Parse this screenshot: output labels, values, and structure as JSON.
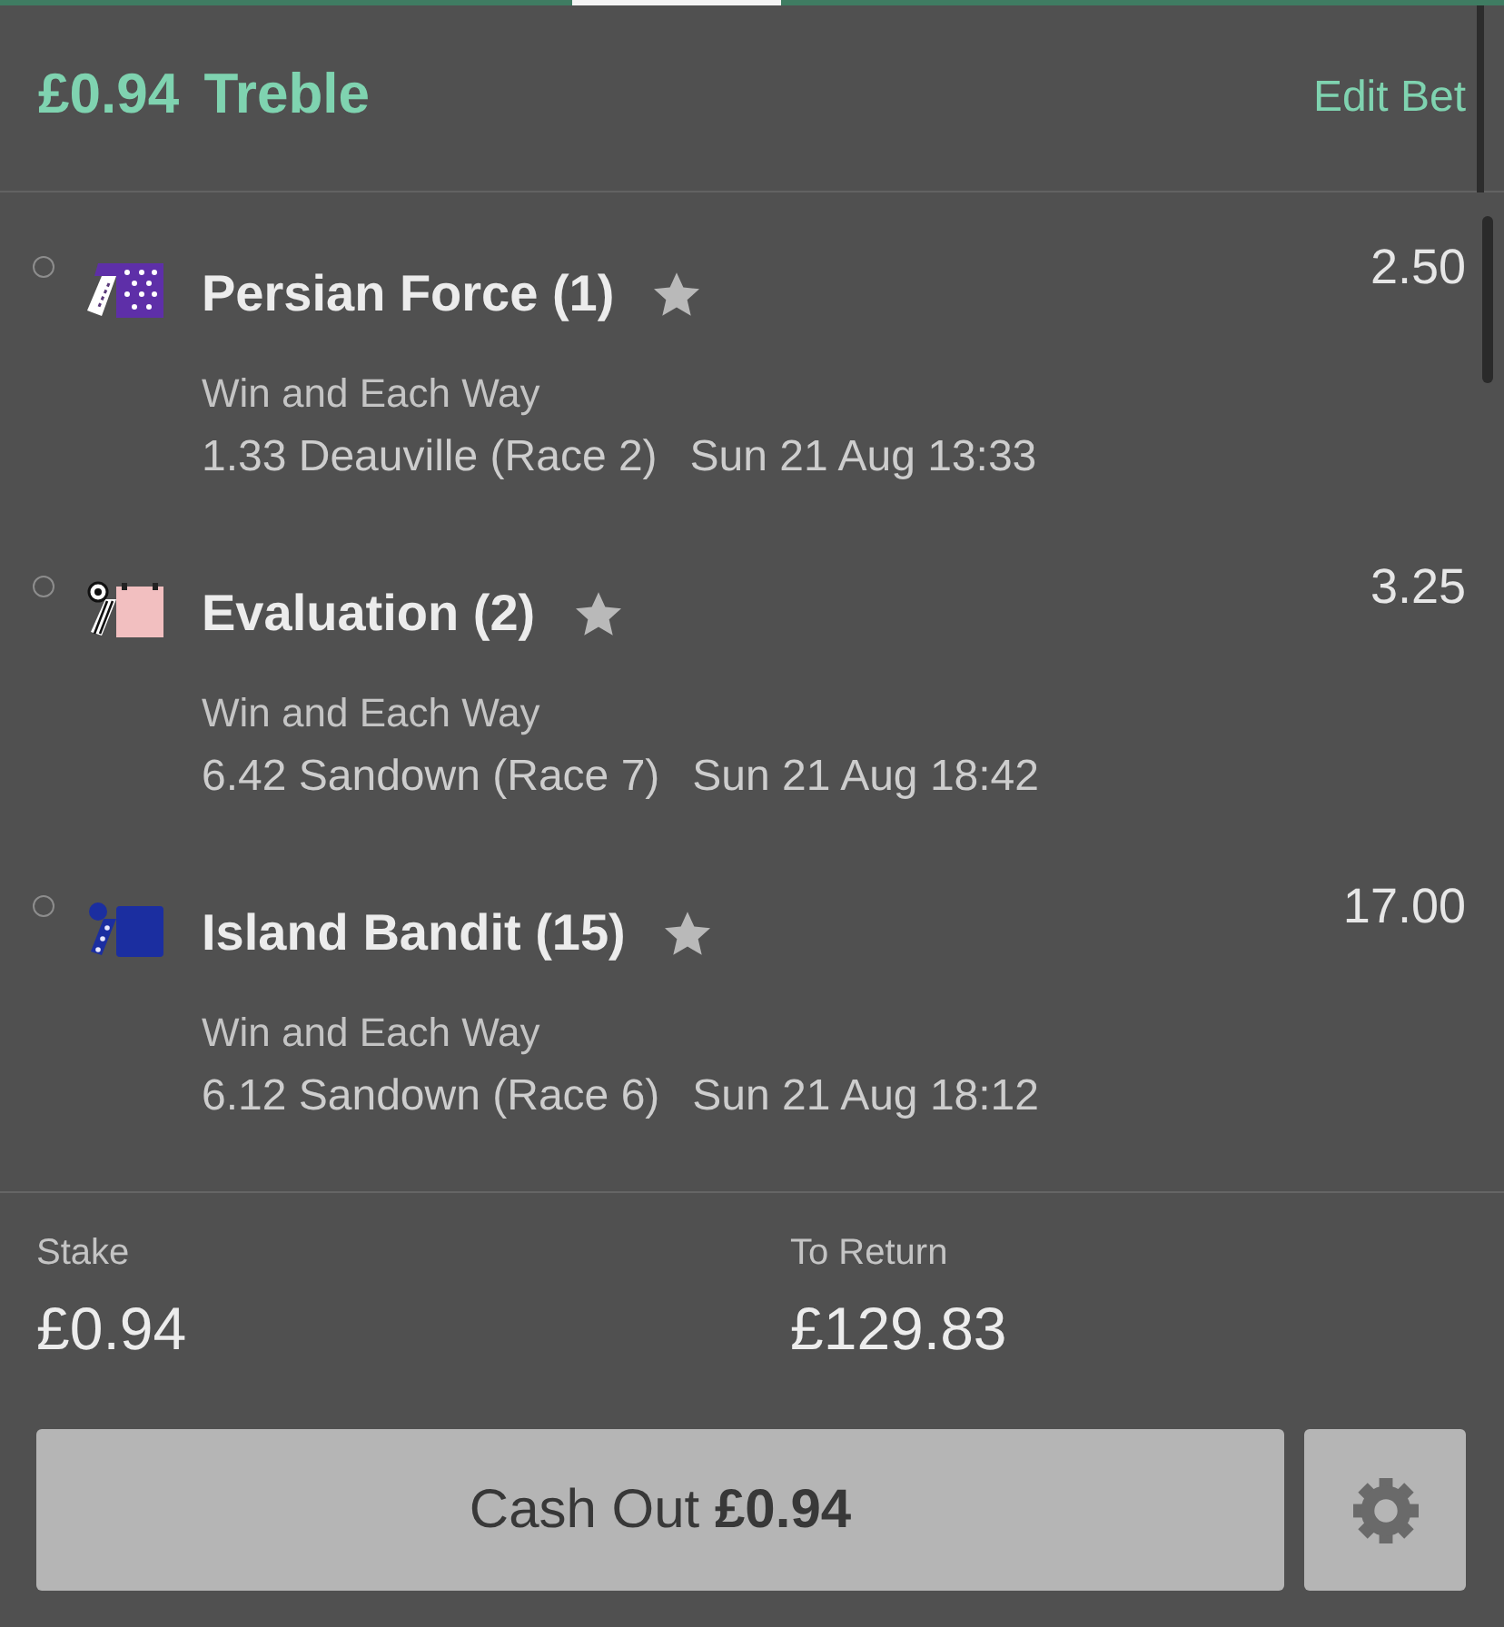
{
  "header": {
    "title": "£0.94 Treble",
    "edit_link": "Edit Bet"
  },
  "selections": [
    {
      "name": "Persian Force (1)",
      "odds": "2.50",
      "market": "Win and Each Way",
      "event": "1.33 Deauville (Race 2)",
      "start_time": "Sun 21 Aug 13:33",
      "silk": {
        "kind": "stars",
        "color": "#5e2fa8"
      }
    },
    {
      "name": "Evaluation (2)",
      "odds": "3.25",
      "market": "Win and Each Way",
      "event": "6.42 Sandown (Race 7)",
      "start_time": "Sun 21 Aug 18:42",
      "silk": {
        "kind": "striped-sleeve",
        "color": "#f2bfc0"
      }
    },
    {
      "name": "Island Bandit (15)",
      "odds": "17.00",
      "market": "Win and Each Way",
      "event": "6.12 Sandown (Race 6)",
      "start_time": "Sun 21 Aug 18:12",
      "silk": {
        "kind": "spotted-sleeve",
        "color": "#1b2ea0"
      }
    }
  ],
  "summary": {
    "stake": {
      "label": "Stake",
      "value": "£0.94"
    },
    "returns": {
      "label": "To Return",
      "value": "£129.83"
    }
  },
  "cash_out_button": {
    "label": "Cash Out **£0.94**"
  }
}
